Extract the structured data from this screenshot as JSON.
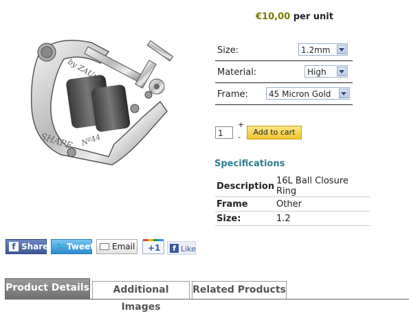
{
  "product": {
    "price_amount": "€10,00",
    "price_unit": "per unit"
  },
  "options": [
    {
      "label": "Size:",
      "value": "1.2mm"
    },
    {
      "label": "Material:",
      "value": "High"
    },
    {
      "label": "Frame:",
      "value": "45 Micron Gold"
    }
  ],
  "cart": {
    "quantity": "1",
    "plus": "+",
    "minus": "-",
    "add_label": "Add to cart"
  },
  "specifications": {
    "title": "Specifications",
    "rows": [
      {
        "key": "Description",
        "value": "16L Ball Closure Ring"
      },
      {
        "key": "Frame",
        "value": "Other"
      },
      {
        "key": "Size:",
        "value": "1.2"
      }
    ]
  },
  "share": {
    "facebook": "Share",
    "twitter": "Tweet",
    "email": "Email",
    "gplus": "+1",
    "like": "Like"
  },
  "tabs": [
    "Product Details",
    "Additional Images",
    "Related Products"
  ],
  "image_engraving": [
    "SHAPE",
    "Nº44",
    "by ZAUro"
  ]
}
